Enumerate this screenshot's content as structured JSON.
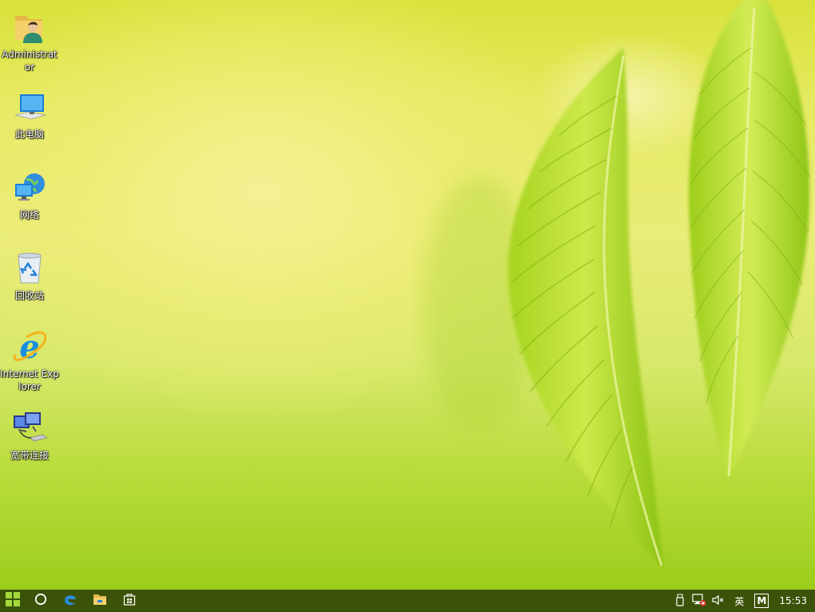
{
  "desktop": {
    "icons": [
      {
        "id": "administrator",
        "label": "Administrator",
        "icon": "user-folder-icon"
      },
      {
        "id": "this-pc",
        "label": "此电脑",
        "icon": "computer-icon"
      },
      {
        "id": "network",
        "label": "网络",
        "icon": "network-icon"
      },
      {
        "id": "recycle-bin",
        "label": "回收站",
        "icon": "recycle-bin-icon"
      },
      {
        "id": "internet-explorer",
        "label": "Internet Explorer",
        "icon": "internet-explorer-icon"
      },
      {
        "id": "broadband",
        "label": "宽带连接",
        "icon": "broadband-connection-icon"
      }
    ]
  },
  "taskbar": {
    "color": "#3c5208",
    "pinned": [
      {
        "id": "start",
        "icon": "windows-start-icon"
      },
      {
        "id": "search",
        "icon": "cortana-circle-icon"
      },
      {
        "id": "edge",
        "icon": "edge-icon"
      },
      {
        "id": "explorer",
        "icon": "file-explorer-icon"
      },
      {
        "id": "store",
        "icon": "store-icon"
      }
    ],
    "tray": {
      "usb_icon": "usb-drive-icon",
      "network_icon": "network-disconnected-icon",
      "volume_icon": "volume-muted-icon",
      "ime_label": "英",
      "ime_mode_label": "M",
      "clock": "15:53"
    }
  }
}
